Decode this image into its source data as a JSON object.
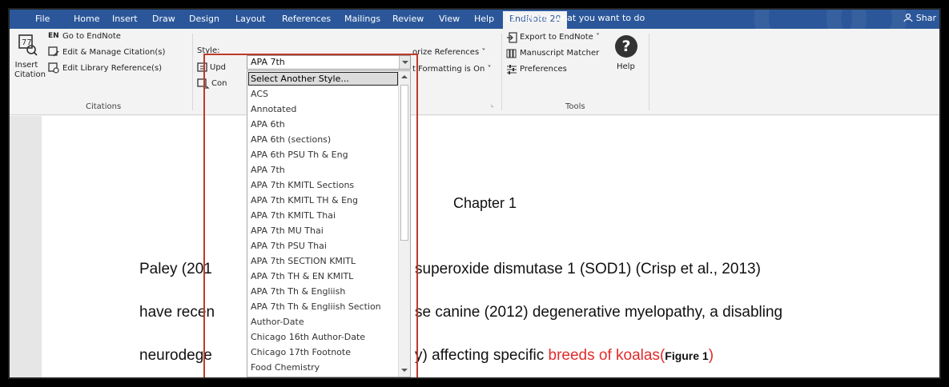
{
  "tabs": [
    "File",
    "Home",
    "Insert",
    "Draw",
    "Design",
    "Layout",
    "References",
    "Mailings",
    "Review",
    "View",
    "Help",
    "EndNote 20"
  ],
  "tell_me": "Tell me what you want to do",
  "share": "Shar",
  "ribbon": {
    "insert_citation": "Insert Citation",
    "go_to_endnote": "Go to EndNote",
    "en_badge": "EN",
    "edit_manage": "Edit & Manage Citation(s)",
    "edit_library": "Edit Library Reference(s)",
    "citations_group": "Citations",
    "style_label": "Style:",
    "style_value": "APA 7th",
    "update_partial": "Upd",
    "convert_partial": "Con",
    "categorize_partial": "orize References",
    "formatting_partial": "t Formatting is On",
    "export": "Export to EndNote",
    "manuscript": "Manuscript Matcher",
    "preferences": "Preferences",
    "help": "Help",
    "tools_group": "Tools"
  },
  "dropdown": {
    "items": [
      "Select Another Style...",
      "ACS",
      "Annotated",
      "APA 6th",
      "APA 6th (sections)",
      "APA 6th PSU Th & Eng",
      "APA 7th",
      "APA 7th KMITL Sections",
      "APA 7th KMITL TH & Eng",
      "APA 7th KMITL Thai",
      "APA 7th MU Thai",
      "APA 7th PSU Thai",
      "APA 7th SECTION KMITL",
      "APA 7th TH & EN KMITL",
      "APA 7th Th & Engliish",
      "APA 7th Th & Engliish Section",
      "Author-Date",
      "Chicago 16th Author-Date",
      "Chicago 17th Footnote",
      "Food Chemistry"
    ]
  },
  "document": {
    "heading": "Chapter 1",
    "line1_left": "Paley (201",
    "line1_right": "superoxide dismutase 1 (SOD1) (Crisp et al., 2013)",
    "line2_left": "have recen",
    "line2_right": "se canine (2012) degenerative myelopathy, a disabling",
    "line3_left": "neurodege",
    "line3_right_black": "y) affecting specific ",
    "line3_right_red": "breeds of koalas",
    "line3_paren_open": "(",
    "line3_figure": "Figure 1",
    "line3_paren_close": ")"
  },
  "colors": {
    "tab_bar": "#2b579a",
    "highlight_box": "#c0392b",
    "red_text": "#e32a2a"
  }
}
